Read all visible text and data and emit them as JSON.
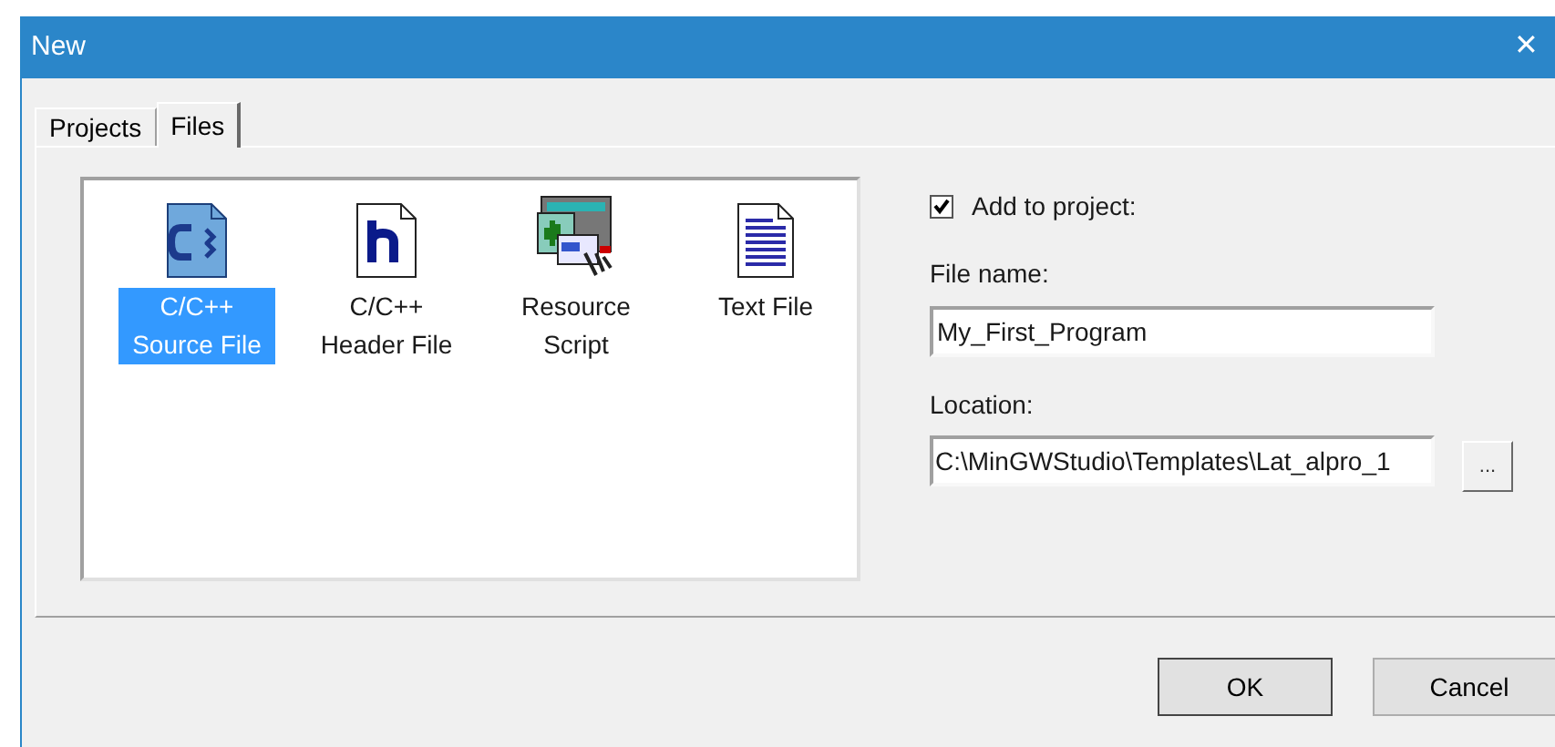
{
  "window": {
    "title": "New",
    "close": "✕"
  },
  "tabs": [
    {
      "label": "Projects",
      "selected": false
    },
    {
      "label": "Files",
      "selected": true
    }
  ],
  "file_types": [
    {
      "kind": "cpp",
      "label": "C/C++ Source File",
      "selected": true
    },
    {
      "kind": "header",
      "label": "C/C++ Header File",
      "selected": false
    },
    {
      "kind": "resource",
      "label": "Resource Script",
      "selected": false
    },
    {
      "kind": "text",
      "label": "Text File",
      "selected": false
    }
  ],
  "add_to_project": {
    "label": "Add to project:",
    "checked": true
  },
  "file_name": {
    "label": "File name:",
    "value": "My_First_Program"
  },
  "location": {
    "label": "Location:",
    "value": "C:\\MinGWStudio\\Templates\\Lat_alpro_1",
    "browse": "..."
  },
  "buttons": [
    "OK",
    "Cancel"
  ]
}
